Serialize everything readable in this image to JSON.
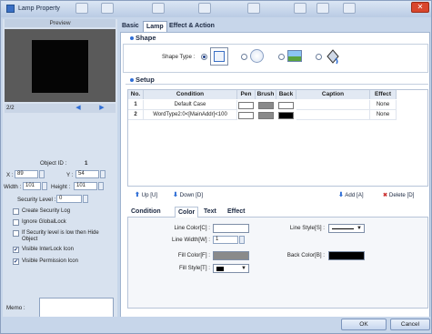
{
  "window": {
    "title": "Lamp Property",
    "close_label": "✕"
  },
  "left": {
    "preview_label": "Preview",
    "page_count": "2/2",
    "object_id_label": "Object ID :",
    "object_id_value": "1",
    "x_label": "X :",
    "x_value": "89",
    "y_label": "Y :",
    "y_value": "54",
    "width_label": "Width :",
    "width_value": "101",
    "height_label": "Height :",
    "height_value": "101",
    "security_label": "Security Level :",
    "security_value": "0",
    "checkboxes": [
      {
        "label": "Create Security Log",
        "checked": false
      },
      {
        "label": "Ignore GlobalLock",
        "checked": false
      },
      {
        "label": "If Security level is low then Hide Object",
        "checked": false
      },
      {
        "label": "Visible InterLock Icon",
        "checked": true
      },
      {
        "label": "Visible Permission Icon",
        "checked": true
      }
    ],
    "memo_label": "Memo :"
  },
  "tabs": [
    "Basic",
    "Lamp",
    "Effect & Action"
  ],
  "shape": {
    "title": "Shape",
    "type_label": "Shape Type :"
  },
  "setup": {
    "title": "Setup",
    "columns": [
      "No.",
      "Condition",
      "Pen",
      "Brush",
      "Back",
      "Caption",
      "Effect"
    ],
    "rows": [
      {
        "no": "1",
        "condition": "Default Case",
        "pen": "#ffffff",
        "brush": "#8a8a8a",
        "back": "#ffffff",
        "caption": "",
        "effect": "None"
      },
      {
        "no": "2",
        "condition": "WordType2:0<[MainAddr]<100",
        "pen": "#ffffff",
        "brush": "#8a8a8a",
        "back": "#000000",
        "caption": "",
        "effect": "None"
      }
    ],
    "up_label": "Up [U]",
    "down_label": "Down [D]",
    "add_label": "Add [A]",
    "delete_label": "Delete [D]"
  },
  "subtabs": [
    "Condition",
    "Color",
    "Text",
    "Effect"
  ],
  "color": {
    "line_color_label": "Line Color[C] :",
    "line_width_label": "Line Width[W] :",
    "line_width_value": "1",
    "line_style_label": "Line Style[S] :",
    "fill_color_label": "Fill Color[F] :",
    "fill_style_label": "Fill Style[T] :",
    "back_color_label": "Back Color[B] :"
  },
  "footer": {
    "ok_label": "OK",
    "cancel_label": "Cancel"
  }
}
